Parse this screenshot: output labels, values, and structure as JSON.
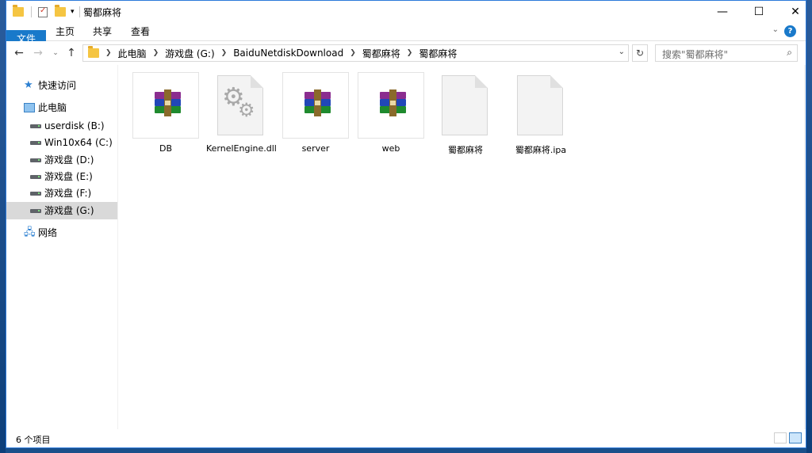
{
  "window": {
    "title": "蜀都麻将",
    "controls": {
      "minimize": "—",
      "maximize": "☐",
      "close": "✕"
    }
  },
  "ribbon": {
    "tabs": [
      "文件",
      "主页",
      "共享",
      "查看"
    ],
    "help": "?"
  },
  "address": {
    "crumbs": [
      "此电脑",
      "游戏盘 (G:)",
      "BaiduNetdiskDownload",
      "蜀都麻将",
      "蜀都麻将"
    ]
  },
  "search": {
    "placeholder": "搜索\"蜀都麻将\""
  },
  "sidebar": {
    "items": [
      {
        "label": "快速访问",
        "icon": "star-icon"
      },
      {
        "label": "此电脑",
        "icon": "computer-icon"
      },
      {
        "label": "userdisk (B:)",
        "icon": "drive-icon"
      },
      {
        "label": "Win10x64 (C:)",
        "icon": "system-drive-icon"
      },
      {
        "label": "游戏盘 (D:)",
        "icon": "drive-icon"
      },
      {
        "label": "游戏盘 (E:)",
        "icon": "drive-icon"
      },
      {
        "label": "游戏盘 (F:)",
        "icon": "drive-icon"
      },
      {
        "label": "游戏盘 (G:)",
        "icon": "drive-icon",
        "selected": true
      },
      {
        "label": "网络",
        "icon": "network-icon"
      }
    ]
  },
  "files": [
    {
      "name": "DB",
      "type": "rar-archive"
    },
    {
      "name": "KernelEngine.dll",
      "type": "dll-gears"
    },
    {
      "name": "server",
      "type": "rar-archive"
    },
    {
      "name": "web",
      "type": "rar-archive"
    },
    {
      "name": "蜀都麻将",
      "type": "blank-file"
    },
    {
      "name": "蜀都麻将.ipa",
      "type": "blank-file"
    }
  ],
  "status": {
    "count_text": "6 个项目"
  },
  "colors": {
    "accent": "#1979ca",
    "selection": "#d9d9d9",
    "border": "#2b79d9"
  }
}
